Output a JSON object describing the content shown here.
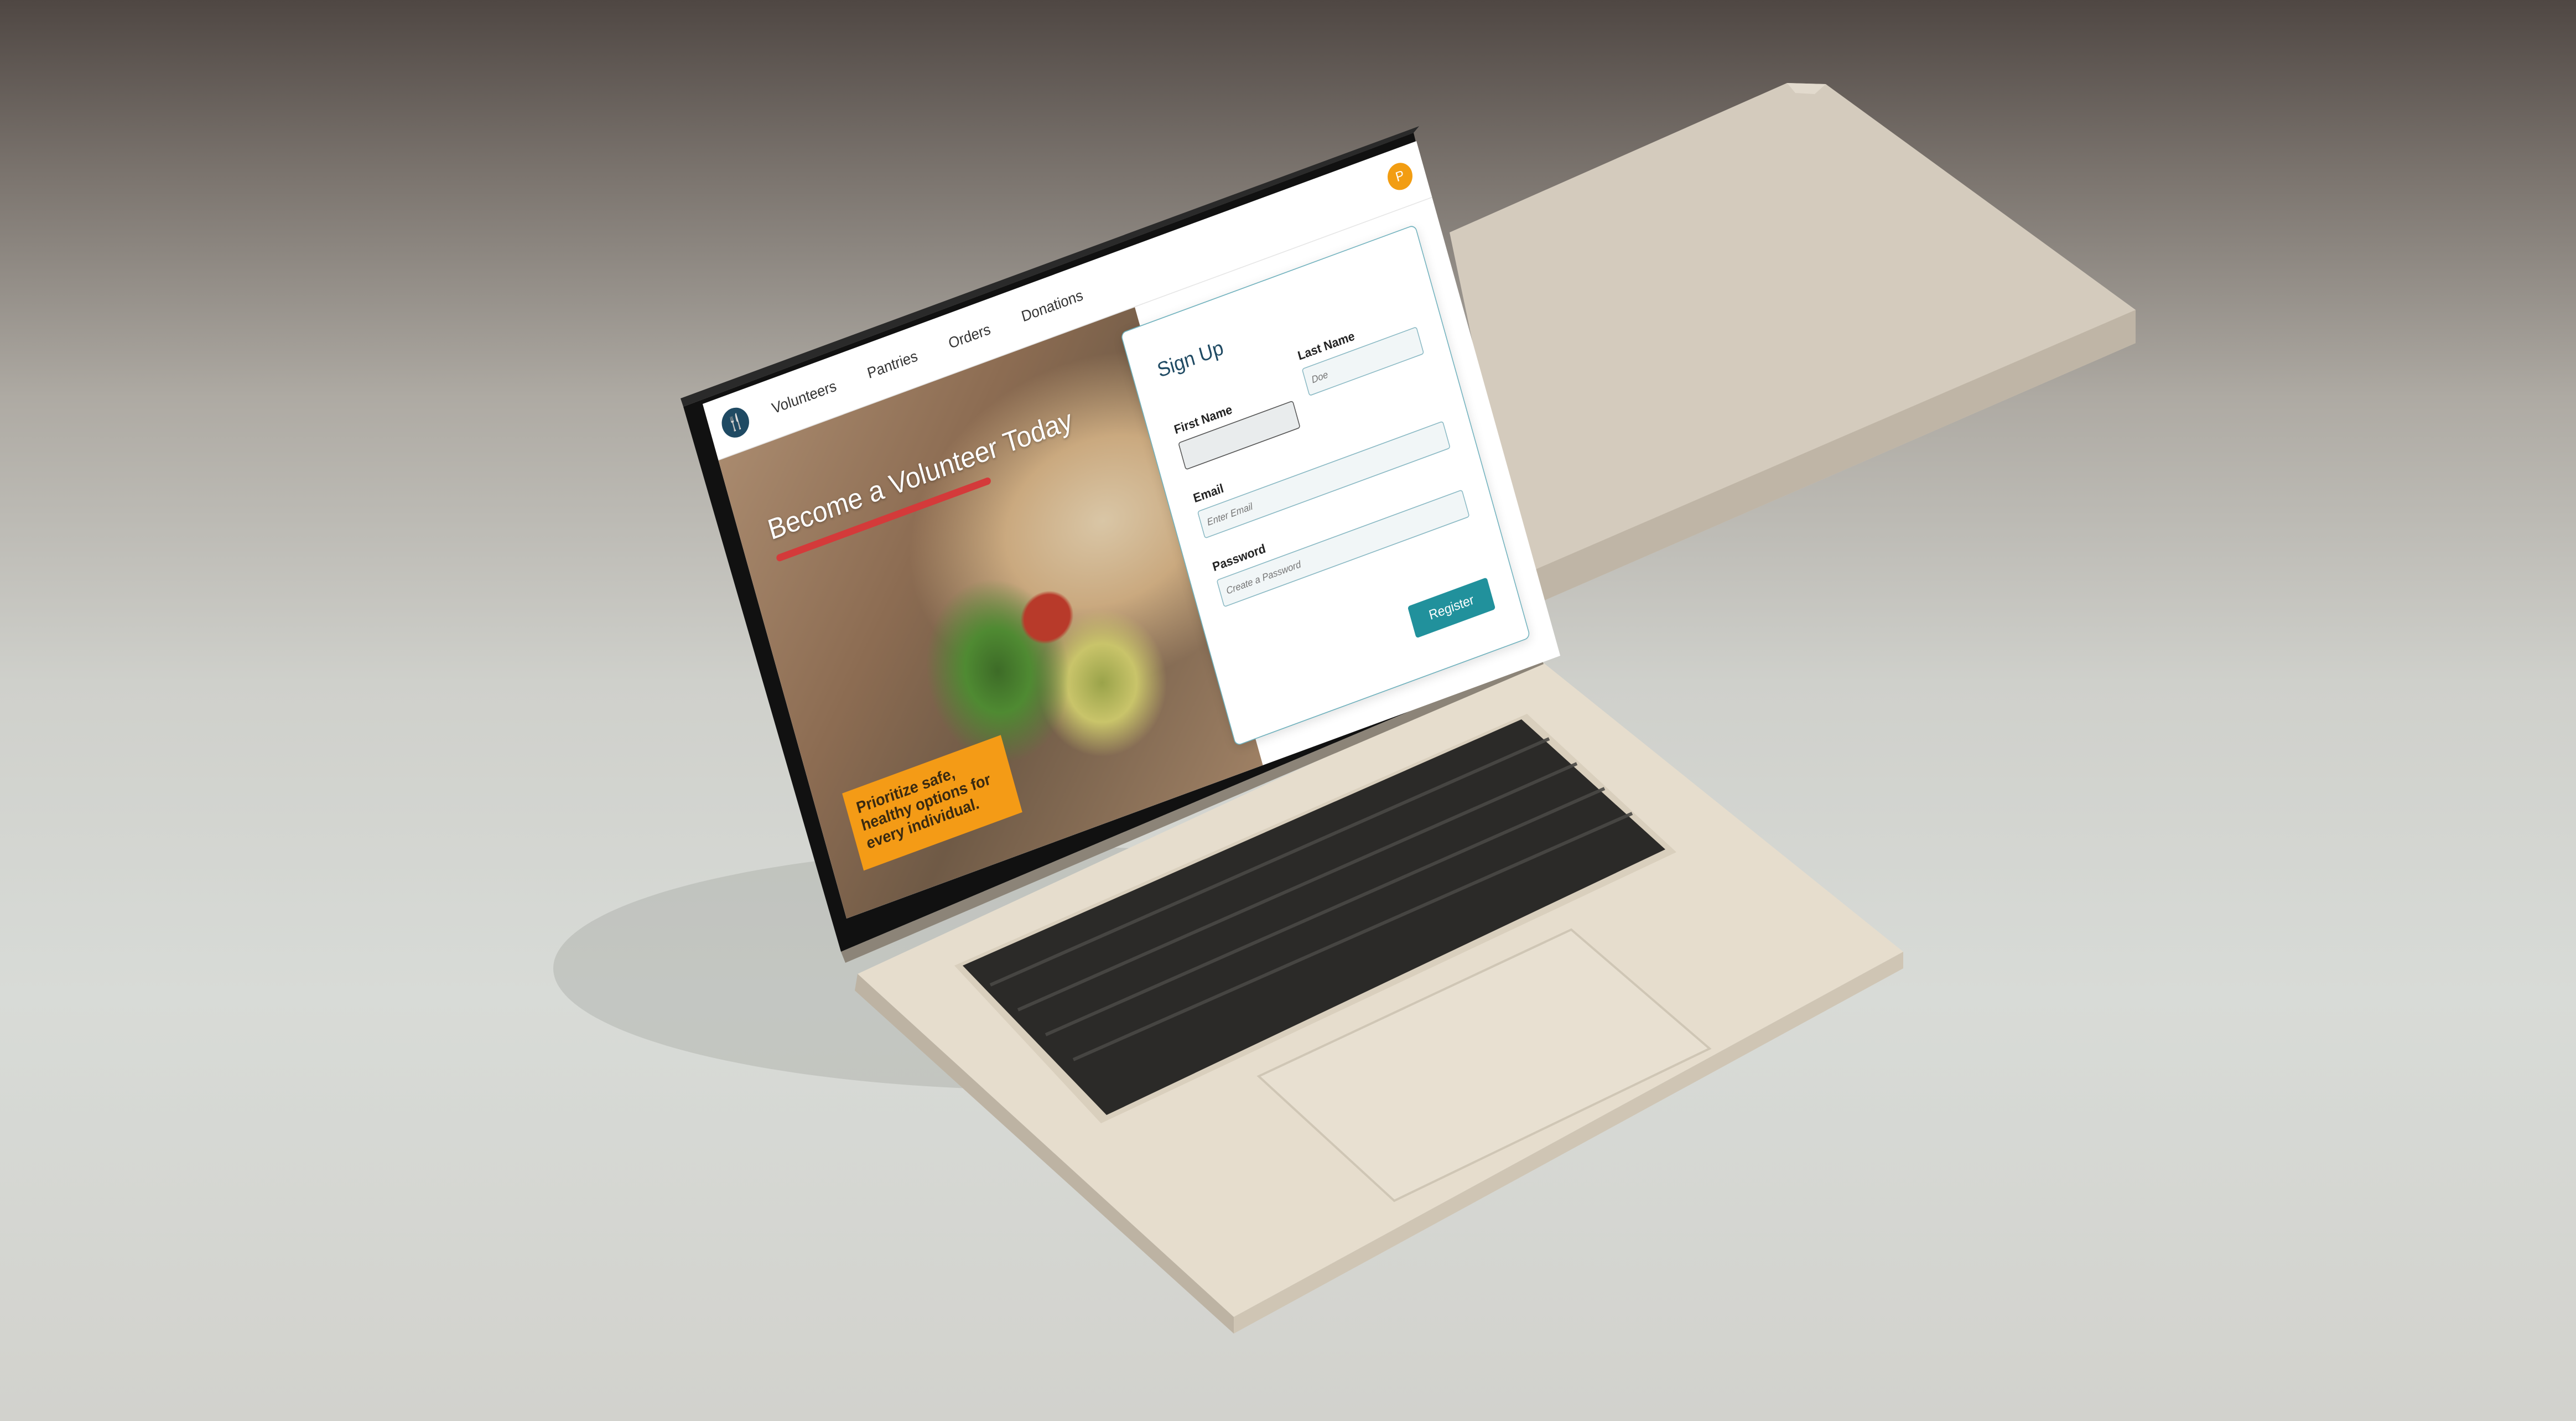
{
  "nav": {
    "logo_icon": "fork-knife-icon",
    "items": [
      {
        "label": "Volunteers"
      },
      {
        "label": "Pantries"
      },
      {
        "label": "Orders"
      },
      {
        "label": "Donations"
      }
    ],
    "avatar_initial": "P",
    "avatar_color": "#f29d12"
  },
  "hero": {
    "title": "Become a Volunteer Today",
    "underline_color": "#d43a3a",
    "tagline": "Prioritize safe, healthy options for every individual.",
    "tagline_bg": "#f49b16"
  },
  "signup": {
    "title": "Sign Up",
    "first_name_label": "First Name",
    "first_name_value": "",
    "last_name_label": "Last Name",
    "last_name_placeholder": "Doe",
    "email_label": "Email",
    "email_placeholder": "Enter Email",
    "password_label": "Password",
    "password_placeholder": "Create a Password",
    "register_label": "Register",
    "accent_color": "#21919c"
  }
}
